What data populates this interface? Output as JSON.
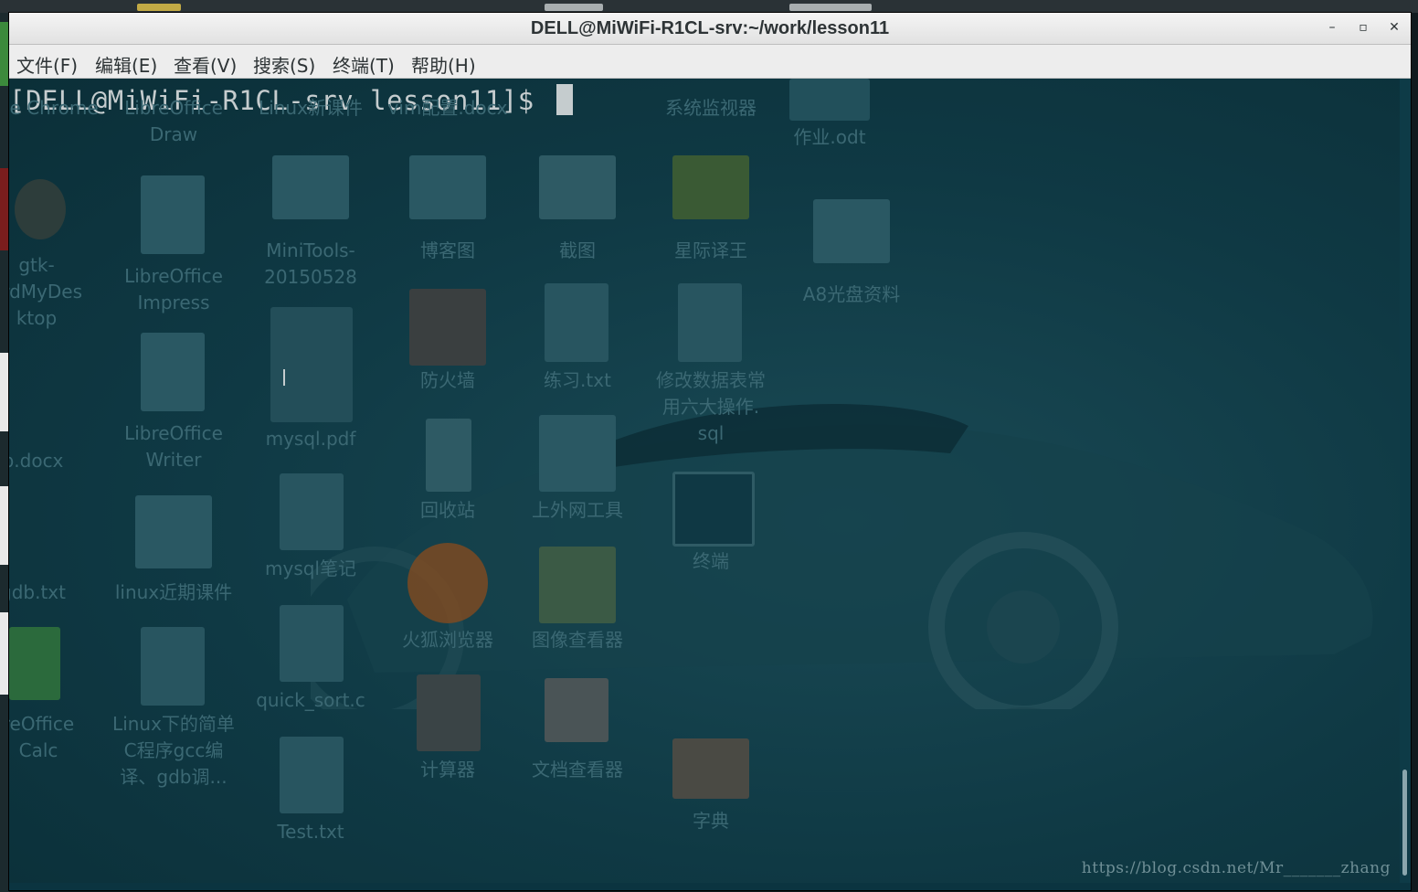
{
  "window": {
    "title": "DELL@MiWiFi-R1CL-srv:~/work/lesson11",
    "minimize_glyph": "–",
    "maximize_glyph": "▫",
    "close_glyph": "✕"
  },
  "menubar": {
    "items": [
      "文件(F)",
      "编辑(E)",
      "查看(V)",
      "搜索(S)",
      "终端(T)",
      "帮助(H)"
    ]
  },
  "terminal": {
    "prompt": "[DELL@MiWiFi-R1CL-srv lesson11]$"
  },
  "desktop_icons": [
    {
      "label": "Google\nChrome",
      "icon": "chrome-icon"
    },
    {
      "label": "LibreOffice\nDraw",
      "icon": "draw-icon"
    },
    {
      "label": "Linux新课件",
      "icon": "folder-icon"
    },
    {
      "label": "vim配置.docx",
      "icon": "doc-icon"
    },
    {
      "label": "系统监视器",
      "icon": "monitor-icon"
    },
    {
      "label": "作业.odt",
      "icon": "doc-icon"
    },
    {
      "label": "gtk-\nordMyDes\nktop",
      "icon": "app-icon"
    },
    {
      "label": "LibreOffice\nImpress",
      "icon": "impress-icon"
    },
    {
      "label": "MiniTools-\n20150528",
      "icon": "folder-icon"
    },
    {
      "label": "博客图",
      "icon": "folder-icon"
    },
    {
      "label": "截图",
      "icon": "camera-icon"
    },
    {
      "label": "星际译王",
      "icon": "dictionary-icon"
    },
    {
      "label": "A8光盘资料",
      "icon": "folder-icon"
    },
    {
      "label": "mysql.pdf",
      "icon": "pdf-icon"
    },
    {
      "label": "防火墙",
      "icon": "firewall-icon"
    },
    {
      "label": "练习.txt",
      "icon": "text-file-icon"
    },
    {
      "label": "修改数据表常\n用六大操作.\nsql",
      "icon": "text-file-icon"
    },
    {
      "label": "LibreOffice\nWriter",
      "icon": "writer-icon"
    },
    {
      "label": "b.docx",
      "icon": "doc-icon"
    },
    {
      "label": "回收站",
      "icon": "trash-icon"
    },
    {
      "label": "上外网工具",
      "icon": "folder-icon"
    },
    {
      "label": "终端",
      "icon": "terminal-icon"
    },
    {
      "label": "gdb.txt",
      "icon": "text-file-icon"
    },
    {
      "label": "linux近期课件",
      "icon": "folder-icon"
    },
    {
      "label": "mysql笔记",
      "icon": "text-file-icon"
    },
    {
      "label": "火狐浏览器",
      "icon": "firefox-icon"
    },
    {
      "label": "图像查看器",
      "icon": "image-viewer-icon"
    },
    {
      "label": "reOffice\nCalc",
      "icon": "calc-icon"
    },
    {
      "label": "Linux下的简单\nC程序gcc编\n译、gdb调...",
      "icon": "doc-icon"
    },
    {
      "label": "quick_sort.c",
      "icon": "text-file-icon"
    },
    {
      "label": "计算器",
      "icon": "calculator-icon"
    },
    {
      "label": "文档查看器",
      "icon": "document-viewer-icon"
    },
    {
      "label": "字典",
      "icon": "book-icon"
    },
    {
      "label": "Test.txt",
      "icon": "text-file-icon"
    }
  ],
  "watermark": "https://blog.csdn.net/Mr_______zhang"
}
